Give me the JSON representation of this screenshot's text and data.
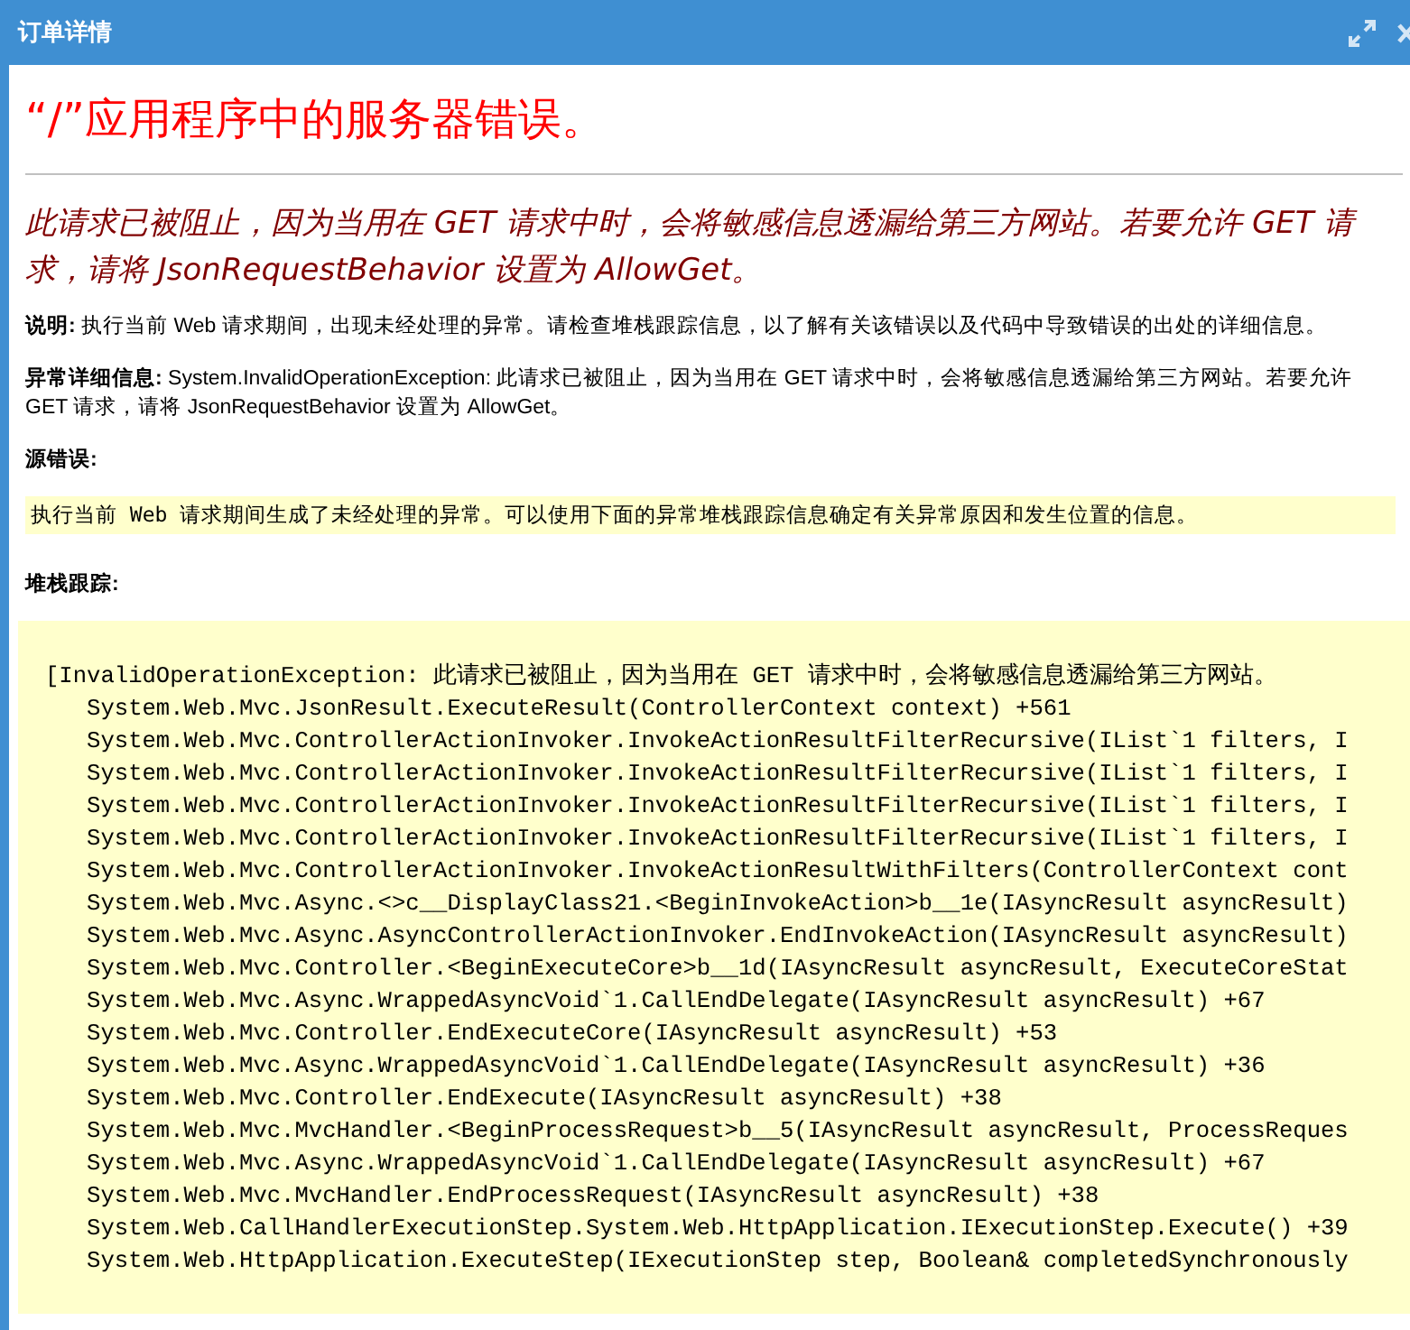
{
  "window": {
    "title": "订单详情"
  },
  "heading": "“/”应用程序中的服务器错误。",
  "message": "此请求已被阻止，因为当用在 GET 请求中时，会将敏感信息透漏给第三方网站。若要允许 GET 请求，请将 JsonRequestBehavior 设置为 AllowGet。",
  "description": "**说明:** 执行当前 Web 请求期间，出现未经处理的异常。请检查堆栈跟踪信息，以了解有关该错误以及代码中导致错误的出处的详细信息。",
  "exception_details": "**异常详细信息:** System.InvalidOperationException: 此请求已被阻止，因为当用在 GET 请求中时，会将敏感信息透漏给第三方网站。若要允许 GET 请求，请将 JsonRequestBehavior 设置为 AllowGet。",
  "source_error": {
    "label": "源错误:",
    "text": "执行当前 Web 请求期间生成了未经处理的异常。可以使用下面的异常堆栈跟踪信息确定有关异常原因和发生位置的信息。"
  },
  "stack_trace": {
    "label": "堆栈跟踪:",
    "lines": [
      "[InvalidOperationException: 此请求已被阻止，因为当用在 GET 请求中时，会将敏感信息透漏给第三方网站。",
      "   System.Web.Mvc.JsonResult.ExecuteResult(ControllerContext context) +561",
      "   System.Web.Mvc.ControllerActionInvoker.InvokeActionResultFilterRecursive(IList`1 filters, I",
      "   System.Web.Mvc.ControllerActionInvoker.InvokeActionResultFilterRecursive(IList`1 filters, I",
      "   System.Web.Mvc.ControllerActionInvoker.InvokeActionResultFilterRecursive(IList`1 filters, I",
      "   System.Web.Mvc.ControllerActionInvoker.InvokeActionResultFilterRecursive(IList`1 filters, I",
      "   System.Web.Mvc.ControllerActionInvoker.InvokeActionResultWithFilters(ControllerContext cont",
      "   System.Web.Mvc.Async.<>c__DisplayClass21.<BeginInvokeAction>b__1e(IAsyncResult asyncResult)",
      "   System.Web.Mvc.Async.AsyncControllerActionInvoker.EndInvokeAction(IAsyncResult asyncResult)",
      "   System.Web.Mvc.Controller.<BeginExecuteCore>b__1d(IAsyncResult asyncResult, ExecuteCoreStat",
      "   System.Web.Mvc.Async.WrappedAsyncVoid`1.CallEndDelegate(IAsyncResult asyncResult) +67",
      "   System.Web.Mvc.Controller.EndExecuteCore(IAsyncResult asyncResult) +53",
      "   System.Web.Mvc.Async.WrappedAsyncVoid`1.CallEndDelegate(IAsyncResult asyncResult) +36",
      "   System.Web.Mvc.Controller.EndExecute(IAsyncResult asyncResult) +38",
      "   System.Web.Mvc.MvcHandler.<BeginProcessRequest>b__5(IAsyncResult asyncResult, ProcessReques",
      "   System.Web.Mvc.Async.WrappedAsyncVoid`1.CallEndDelegate(IAsyncResult asyncResult) +67",
      "   System.Web.Mvc.MvcHandler.EndProcessRequest(IAsyncResult asyncResult) +38",
      "   System.Web.CallHandlerExecutionStep.System.Web.HttpApplication.IExecutionStep.Execute() +39",
      "   System.Web.HttpApplication.ExecuteStep(IExecutionStep step, Boolean& completedSynchronously"
    ]
  }
}
